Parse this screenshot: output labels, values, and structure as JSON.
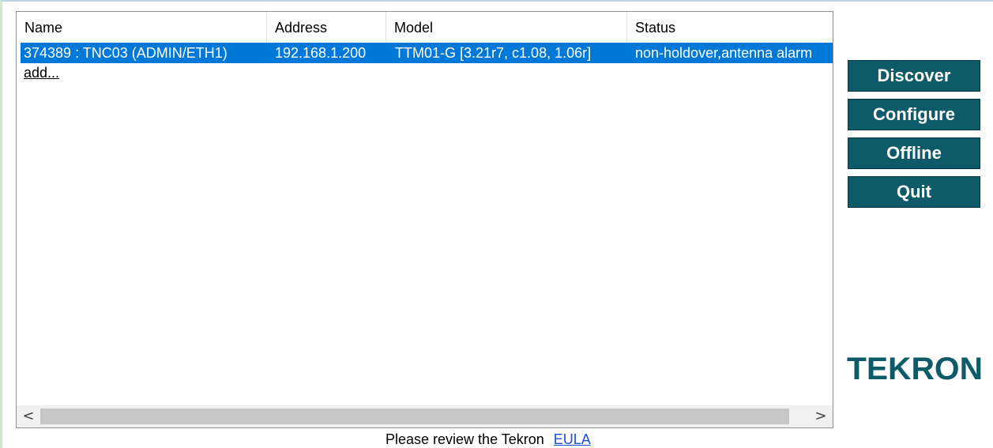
{
  "device_list": {
    "columns": [
      "Name",
      "Address",
      "Model",
      "Status"
    ],
    "rows": [
      {
        "name": "374389 : TNC03 (ADMIN/ETH1)",
        "address": "192.168.1.200",
        "model": "TTM01-G [3.21r7, c1.08, 1.06r]",
        "status": "non-holdover,antenna alarm",
        "selected": true
      }
    ],
    "add_label": "add...",
    "scroll_left": "<",
    "scroll_right": ">"
  },
  "buttons": {
    "discover": "Discover",
    "configure": "Configure",
    "offline": "Offline",
    "quit": "Quit"
  },
  "logo": {
    "text": "TEKRON",
    "color": "#0d5a69"
  },
  "footer": {
    "text": "Please review the Tekron",
    "link": "EULA"
  },
  "colors": {
    "button_bg": "#0d5a69",
    "selection": "#0078d7",
    "link": "#1a4fd6"
  }
}
